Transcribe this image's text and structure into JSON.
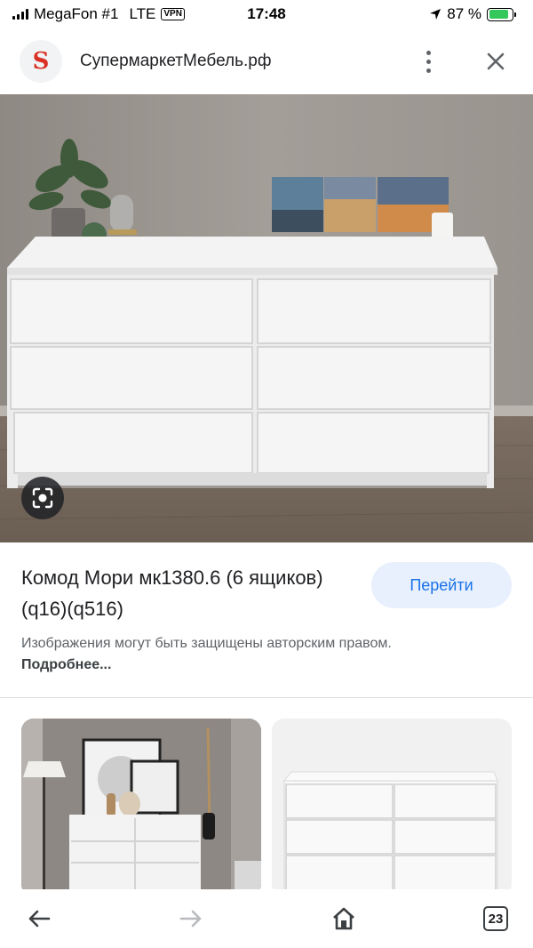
{
  "status_bar": {
    "carrier": "MegaFon #1",
    "network": "LTE",
    "vpn": "VPN",
    "time": "17:48",
    "battery_percent": "87 %",
    "battery_level": 0.87
  },
  "header": {
    "site_logo_letter": "S",
    "site_name": "СупермаркетМебель.рф",
    "menu_icon": "more-vert-icon",
    "close_icon": "close-icon"
  },
  "main": {
    "title": "Комод Мори мк1380.6 (6 ящиков) (q16)(q516)",
    "goto_label": "Перейти",
    "notice_text": "Изображения могут быть защищены авторским правом.",
    "notice_link": "Подробнее..."
  },
  "bottom_bar": {
    "back_icon": "arrow-back-icon",
    "forward_icon": "arrow-forward-icon",
    "home_icon": "home-icon",
    "tabs_count": "23"
  },
  "colors": {
    "accent": "#1a73e8",
    "button_bg": "#e8f0fe",
    "logo_red": "#d93025"
  }
}
